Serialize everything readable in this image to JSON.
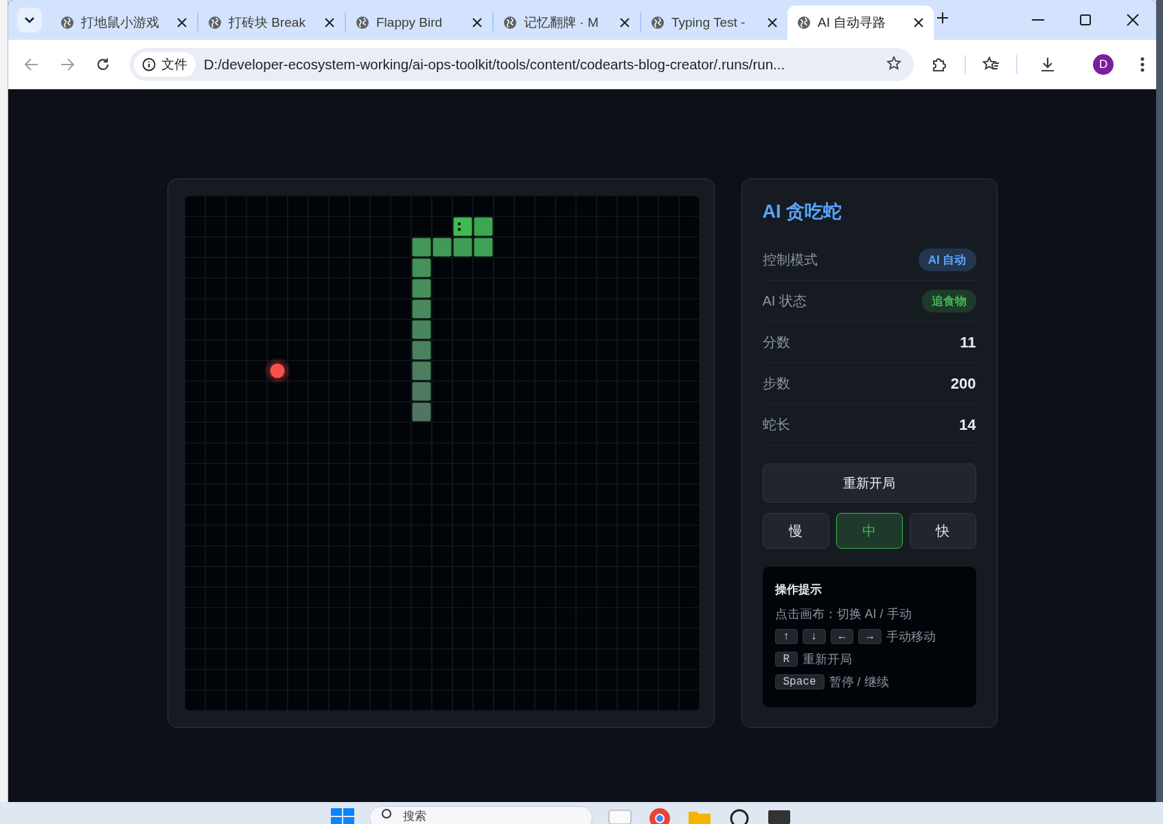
{
  "browser": {
    "tabs": [
      {
        "title": "打地鼠小游戏",
        "selected": false
      },
      {
        "title": "打砖块 Break",
        "selected": false
      },
      {
        "title": "Flappy Bird",
        "selected": false
      },
      {
        "title": "记忆翻牌 · M",
        "selected": false
      },
      {
        "title": "Typing Test -",
        "selected": false
      },
      {
        "title": "AI 自动寻路",
        "selected": true
      }
    ],
    "address_bar": {
      "security_label": "文件",
      "url": "D:/developer-ecosystem-working/ai-ops-toolkit/tools/content/codearts-blog-creator/.runs/run..."
    },
    "profile_initial": "D"
  },
  "panel": {
    "title": "AI 贪吃蛇",
    "stats": [
      {
        "label": "控制模式",
        "value": "AI 自动",
        "kind": "badge",
        "color": "#58a6ff"
      },
      {
        "label": "AI 状态",
        "value": "追食物",
        "kind": "badge",
        "color": "#3fb950"
      },
      {
        "label": "分数",
        "value": "11",
        "kind": "number"
      },
      {
        "label": "步数",
        "value": "200",
        "kind": "number"
      },
      {
        "label": "蛇长",
        "value": "14",
        "kind": "number"
      }
    ],
    "restart_button": "重新开局",
    "speeds": [
      {
        "label": "慢",
        "selected": false
      },
      {
        "label": "中",
        "selected": true
      },
      {
        "label": "快",
        "selected": false
      }
    ],
    "hints": {
      "title": "操作提示",
      "lines": [
        {
          "text": "点击画布：切换 AI / 手动"
        },
        {
          "keys": [
            "↑",
            "↓",
            "←",
            "→"
          ],
          "text": "手动移动"
        },
        {
          "keys": [
            "R"
          ],
          "text": "重新开局"
        },
        {
          "keys": [
            "Space"
          ],
          "text": "暂停 / 继续"
        }
      ]
    }
  },
  "taskbar": {
    "search_placeholder": "搜索"
  }
}
